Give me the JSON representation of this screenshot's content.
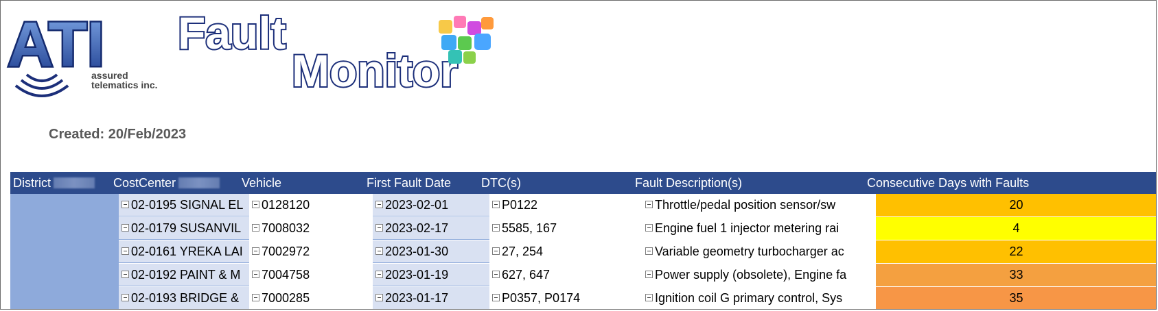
{
  "logo": {
    "brand": "ATI",
    "tagline_line1": "assured",
    "tagline_line2": "telematics inc.",
    "product_word1": "Fault",
    "product_word2": "Monitor"
  },
  "created_label": "Created: 20/Feb/2023",
  "table": {
    "headers": {
      "district": "District",
      "costcenter": "CostCenter",
      "vehicle": "Vehicle",
      "first_fault_date": "First Fault Date",
      "dtcs": "DTC(s)",
      "fault_descriptions": "Fault Description(s)",
      "consecutive_days": "Consecutive Days with Faults"
    },
    "rows": [
      {
        "costcenter": "02-0195 SIGNAL EL",
        "vehicle": "0128120",
        "date": "2023-02-01",
        "dtc": "P0122",
        "desc": "Throttle/pedal position sensor/sw",
        "days": "20",
        "color": "#ffc000"
      },
      {
        "costcenter": "02-0179 SUSANVIL",
        "vehicle": "7008032",
        "date": "2023-02-17",
        "dtc": "5585, 167",
        "desc": "Engine fuel 1 injector metering rai",
        "days": "4",
        "color": "#ffff00"
      },
      {
        "costcenter": "02-0161 YREKA LAI",
        "vehicle": "7002972",
        "date": "2023-01-30",
        "dtc": "27, 254",
        "desc": "Variable geometry turbocharger ac",
        "days": "22",
        "color": "#ffc000"
      },
      {
        "costcenter": "02-0192 PAINT & M",
        "vehicle": "7004758",
        "date": "2023-01-19",
        "dtc": "627, 647",
        "desc": "Power supply (obsolete), Engine fa",
        "days": "33",
        "color": "#f4a040"
      },
      {
        "costcenter": "02-0193 BRIDGE &",
        "vehicle": "7000285",
        "date": "2023-01-17",
        "dtc": "P0357, P0174",
        "desc": "Ignition coil G primary control, Sys",
        "days": "35",
        "color": "#f79646"
      }
    ]
  },
  "colors": {
    "header_bg": "#2d4b8c",
    "district_bg": "#8eaadb",
    "alt_col_bg": "#d9e1f2"
  }
}
